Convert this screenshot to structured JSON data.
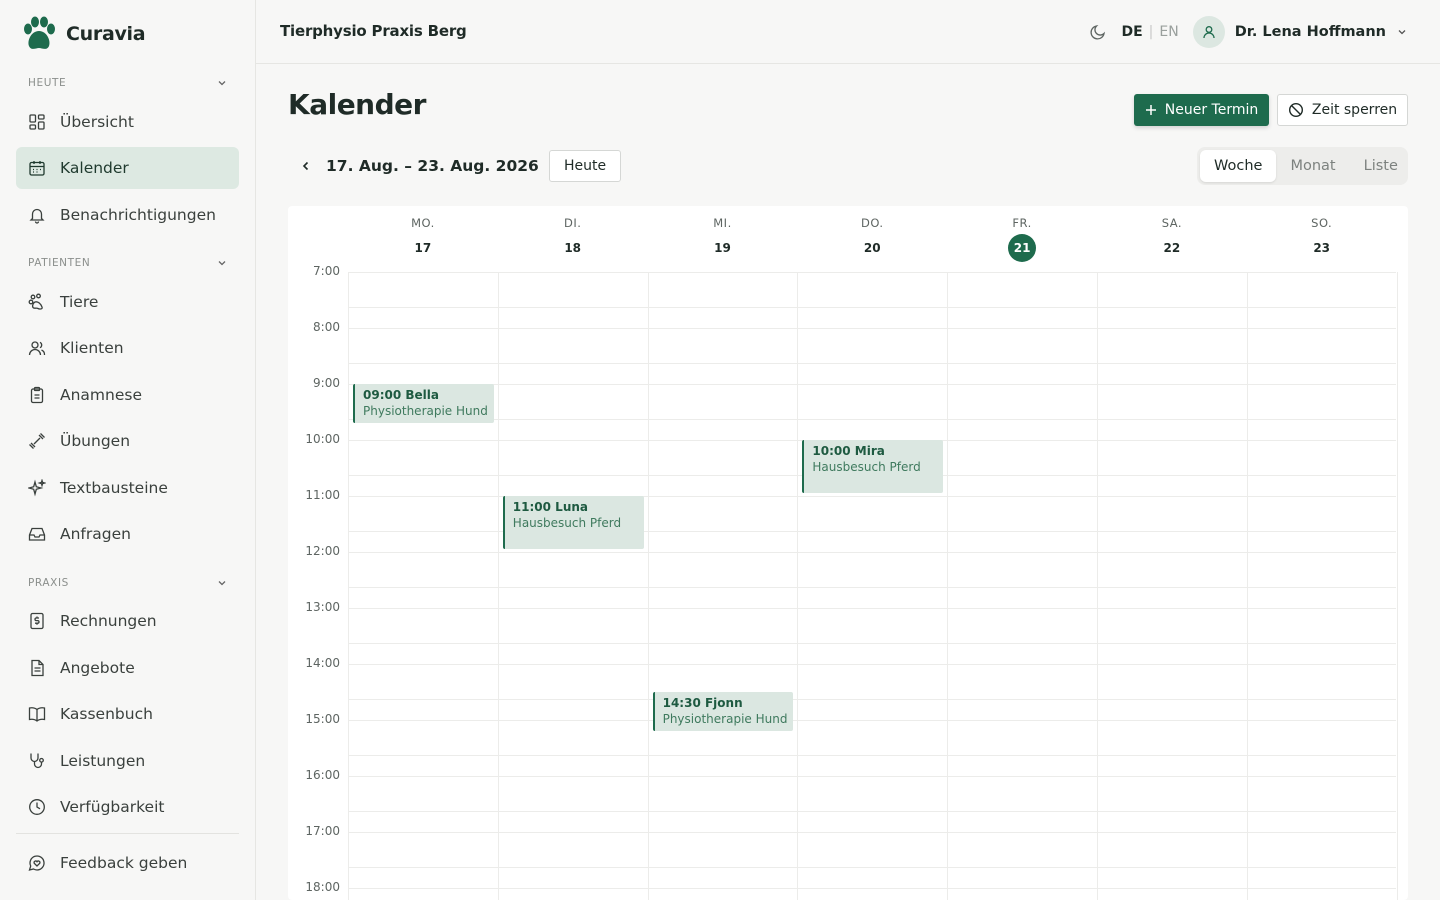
{
  "app": {
    "name": "Curavia"
  },
  "sidebar": {
    "sections": [
      {
        "label": "HEUTE"
      },
      {
        "label": "PATIENTEN"
      },
      {
        "label": "PRAXIS"
      }
    ],
    "items": [
      {
        "label": "Übersicht"
      },
      {
        "label": "Kalender"
      },
      {
        "label": "Benachrichtigungen"
      },
      {
        "label": "Tiere"
      },
      {
        "label": "Klienten"
      },
      {
        "label": "Anamnese"
      },
      {
        "label": "Übungen"
      },
      {
        "label": "Textbausteine"
      },
      {
        "label": "Anfragen"
      },
      {
        "label": "Rechnungen"
      },
      {
        "label": "Angebote"
      },
      {
        "label": "Kassenbuch"
      },
      {
        "label": "Leistungen"
      },
      {
        "label": "Verfügbarkeit"
      }
    ],
    "feedback": "Feedback geben"
  },
  "header": {
    "practice": "Tierphysio Praxis Berg",
    "lang_active": "DE",
    "lang_sep": "|",
    "lang_other": "EN",
    "user": "Dr. Lena Hoffmann"
  },
  "page": {
    "title": "Kalender",
    "new_button": "Neuer Termin",
    "block_button": "Zeit sperren",
    "range": "17. Aug. – 23. Aug. 2026",
    "today_button": "Heute",
    "views": [
      "Woche",
      "Monat",
      "Liste"
    ],
    "active_view": "Woche"
  },
  "calendar": {
    "days": [
      {
        "dow": "MO.",
        "num": "17"
      },
      {
        "dow": "DI.",
        "num": "18"
      },
      {
        "dow": "MI.",
        "num": "19"
      },
      {
        "dow": "DO.",
        "num": "20"
      },
      {
        "dow": "FR.",
        "num": "21",
        "today": true
      },
      {
        "dow": "SA.",
        "num": "22"
      },
      {
        "dow": "SO.",
        "num": "23"
      }
    ],
    "hours": [
      "7:00",
      "8:00",
      "9:00",
      "10:00",
      "11:00",
      "12:00",
      "13:00",
      "14:00",
      "15:00",
      "16:00",
      "17:00",
      "18:00"
    ],
    "events": [
      {
        "day": 0,
        "start": 9.0,
        "end": 9.7,
        "title": "09:00 Bella",
        "sub": "Physiotherapie Hund"
      },
      {
        "day": 1,
        "start": 11.0,
        "end": 11.95,
        "title": "11:00 Luna",
        "sub": "Hausbesuch Pferd"
      },
      {
        "day": 3,
        "start": 10.0,
        "end": 10.95,
        "title": "10:00 Mira",
        "sub": "Hausbesuch Pferd"
      },
      {
        "day": 2,
        "start": 14.5,
        "end": 15.2,
        "title": "14:30 Fjonn",
        "sub": "Physiotherapie Hund"
      }
    ]
  },
  "colors": {
    "accent": "#1e6b4d",
    "event_bg": "#dbe7e1",
    "active_nav": "#dde9e2"
  }
}
